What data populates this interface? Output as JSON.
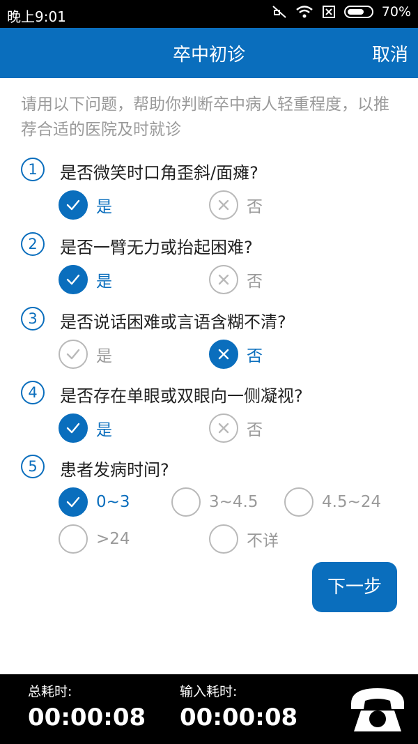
{
  "status": {
    "time": "晚上9:01",
    "battery": "70%"
  },
  "header": {
    "title": "卒中初诊",
    "cancel": "取消"
  },
  "intro": "请用以下问题，帮助你判断卒中病人轻重程度，以推荐合适的医院及时就诊",
  "questions": [
    {
      "num": "1",
      "text": "是否微笑时口角歪斜/面瘫?",
      "options": [
        {
          "label": "是",
          "state": "check-selected"
        },
        {
          "label": "否",
          "state": "x-unselected"
        }
      ]
    },
    {
      "num": "2",
      "text": "是否一臂无力或抬起困难?",
      "options": [
        {
          "label": "是",
          "state": "check-selected"
        },
        {
          "label": "否",
          "state": "x-unselected"
        }
      ]
    },
    {
      "num": "3",
      "text": "是否说话困难或言语含糊不清?",
      "options": [
        {
          "label": "是",
          "state": "check-unselected"
        },
        {
          "label": "否",
          "state": "x-selected"
        }
      ]
    },
    {
      "num": "4",
      "text": "是否存在单眼或双眼向一侧凝视?",
      "options": [
        {
          "label": "是",
          "state": "check-selected"
        },
        {
          "label": "否",
          "state": "x-unselected"
        }
      ]
    },
    {
      "num": "5",
      "text": "患者发病时间?",
      "options": [
        {
          "label": "0~3",
          "state": "check-selected"
        },
        {
          "label": "3~4.5",
          "state": "empty"
        },
        {
          "label": "4.5~24",
          "state": "empty"
        },
        {
          "label": ">24",
          "state": "empty"
        },
        {
          "label": "不详",
          "state": "empty"
        }
      ]
    }
  ],
  "next_button": "下一步",
  "footer": {
    "total_label": "总耗时:",
    "total_value": "00:00:08",
    "input_label": "输入耗时:",
    "input_value": "00:00:08"
  },
  "colors": {
    "accent": "#0a6ebd",
    "muted": "#9a9a9a",
    "footer_bg": "#000000"
  }
}
